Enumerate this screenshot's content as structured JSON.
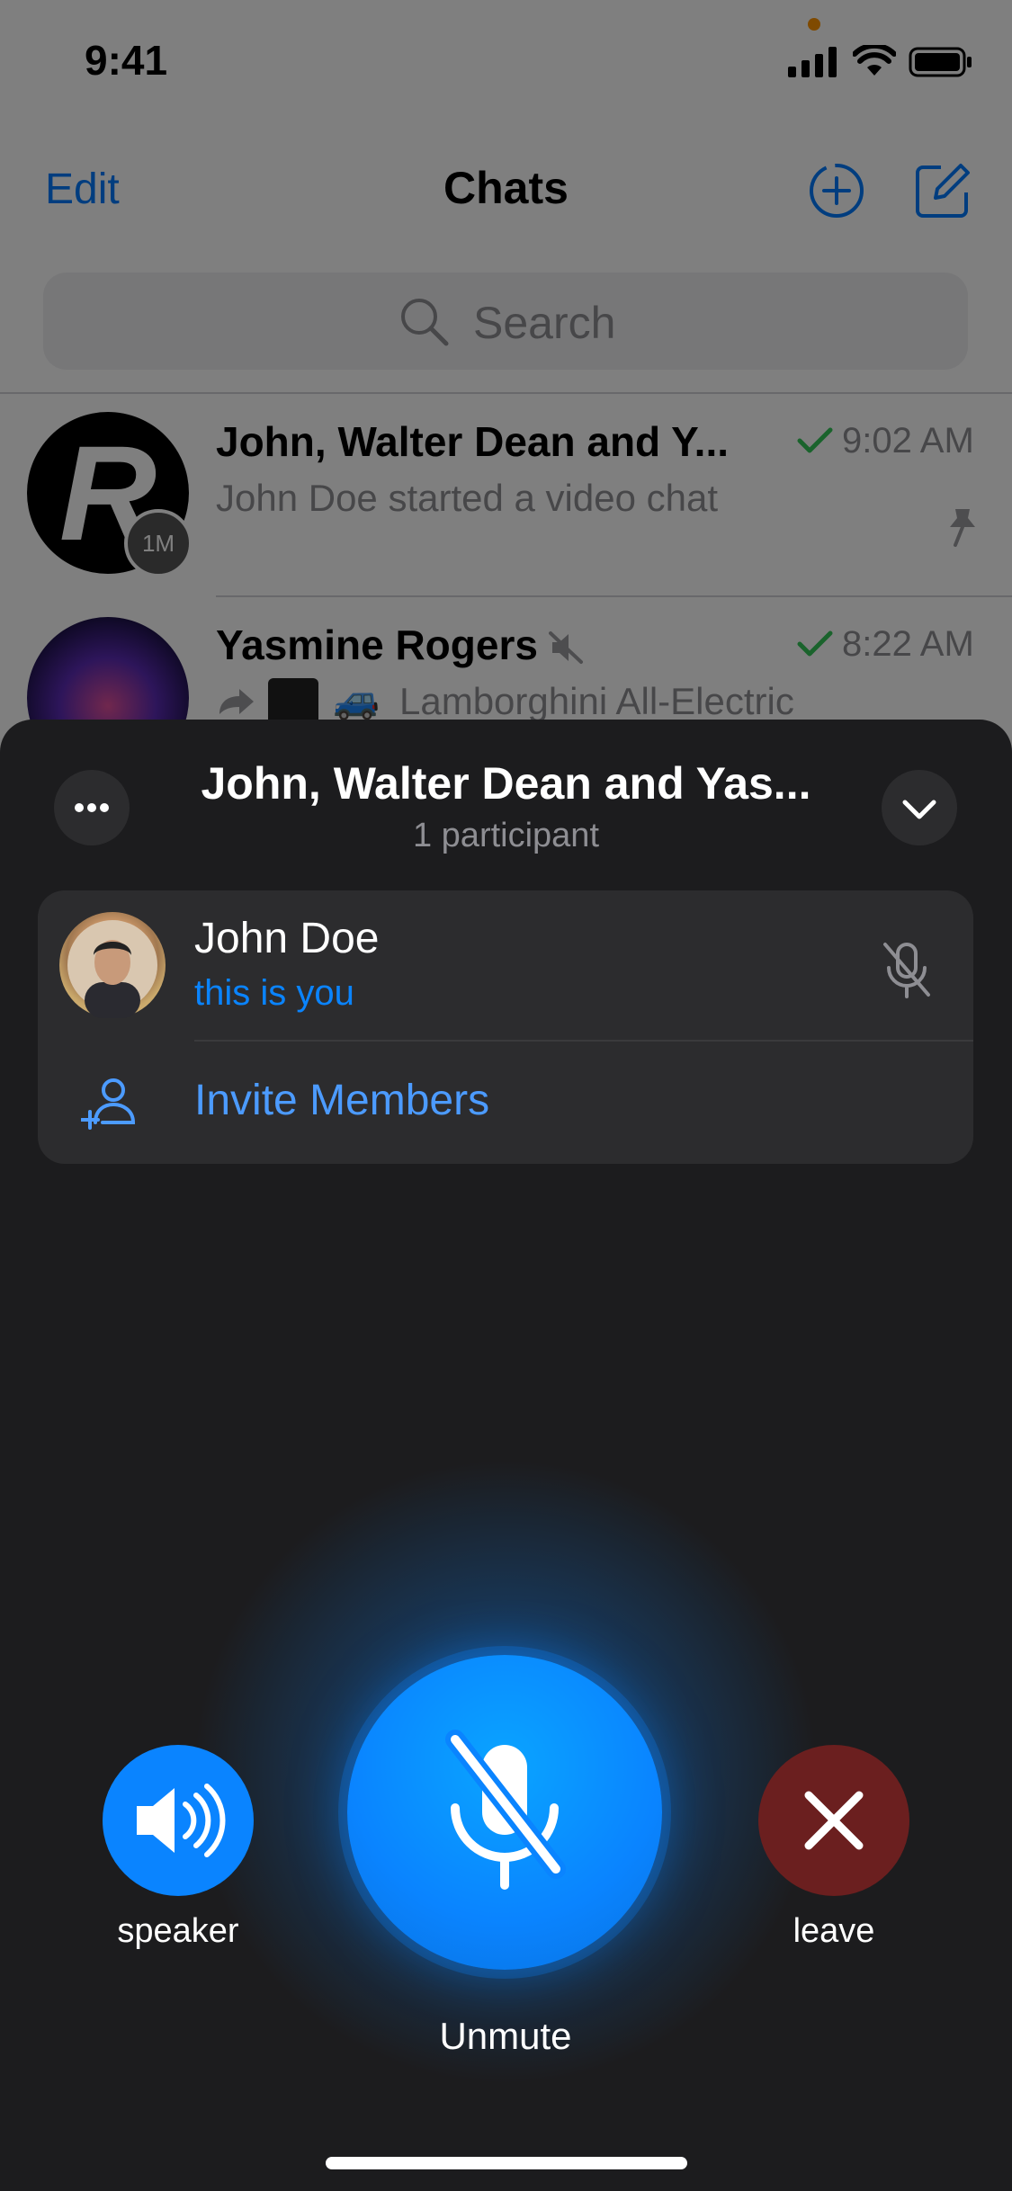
{
  "status_bar": {
    "time": "9:41"
  },
  "chats_screen": {
    "nav": {
      "edit_label": "Edit",
      "title": "Chats"
    },
    "search": {
      "placeholder": "Search"
    },
    "chats": [
      {
        "name": "John, Walter Dean and Y...",
        "avatar_letter": "R",
        "timer_badge": "1M",
        "message": "John Doe started a video chat",
        "time": "9:02 AM",
        "pinned": true
      },
      {
        "name": "Yasmine Rogers",
        "muted": true,
        "message": "Lamborghini All-Electric",
        "time": "8:22 AM"
      }
    ]
  },
  "call": {
    "title": "John, Walter Dean and Yas...",
    "subtitle": "1 participant",
    "participant": {
      "name": "John Doe",
      "status": "this is you"
    },
    "invite_label": "Invite Members",
    "controls": {
      "speaker_label": "speaker",
      "unmute_label": "Unmute",
      "leave_label": "leave"
    }
  },
  "colors": {
    "accent": "#0a84ff",
    "leave": "#6b1f1f",
    "sheet_bg": "#1c1c1e",
    "card_bg": "#2c2c2e",
    "status_dot": "#ff9500",
    "read_check": "#34c759"
  },
  "icons": [
    "signal-icon",
    "wifi-icon",
    "battery-icon",
    "new-group-icon",
    "compose-icon",
    "search-icon",
    "checkmark-icon",
    "pin-icon",
    "muted-icon",
    "more-icon",
    "chevron-down-icon",
    "mic-off-icon",
    "add-person-icon",
    "speaker-icon",
    "close-icon"
  ]
}
